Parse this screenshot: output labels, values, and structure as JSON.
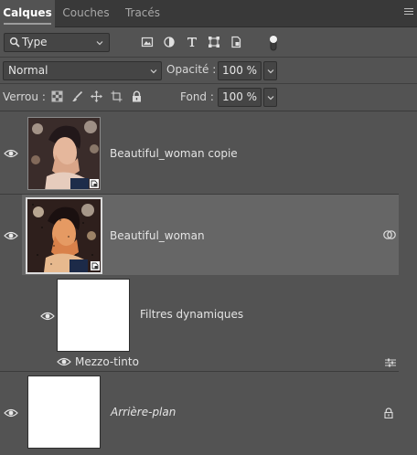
{
  "tabs": [
    {
      "label": "Calques",
      "active": true
    },
    {
      "label": "Couches",
      "active": false
    },
    {
      "label": "Tracés",
      "active": false
    }
  ],
  "filter": {
    "kind_label": "Type",
    "icons": [
      "image-filter-icon",
      "adjustment-filter-icon",
      "type-filter-icon",
      "shape-filter-icon",
      "smart-object-filter-icon"
    ]
  },
  "blend": {
    "mode": "Normal",
    "opacity_label": "Opacité :",
    "opacity_value": "100 %",
    "fill_label": "Fond :",
    "fill_value": "100 %"
  },
  "locks": {
    "label": "Verrou :",
    "icons": [
      "lock-transparent-pixels-icon",
      "lock-image-pixels-icon",
      "lock-position-icon",
      "lock-artboard-icon",
      "lock-all-icon"
    ]
  },
  "layers": [
    {
      "name": "Beautiful_woman  copie",
      "visible": true,
      "selected": false,
      "smart_object": true
    },
    {
      "name": "Beautiful_woman",
      "visible": true,
      "selected": true,
      "smart_object": true
    },
    {
      "name": "Filtres dynamiques",
      "visible": true,
      "selected": false,
      "smart_filter_mask": true
    },
    {
      "name": "Mezzo-tinto",
      "visible": true,
      "selected": false,
      "smart_filter": true
    },
    {
      "name": "Arrière-plan",
      "visible": true,
      "selected": false,
      "locked": true,
      "italic": true
    }
  ],
  "colors": {
    "panel_bg": "#535353",
    "selected_row": "#666666",
    "tabbar_bg": "#393939",
    "field_bg": "#454545"
  }
}
